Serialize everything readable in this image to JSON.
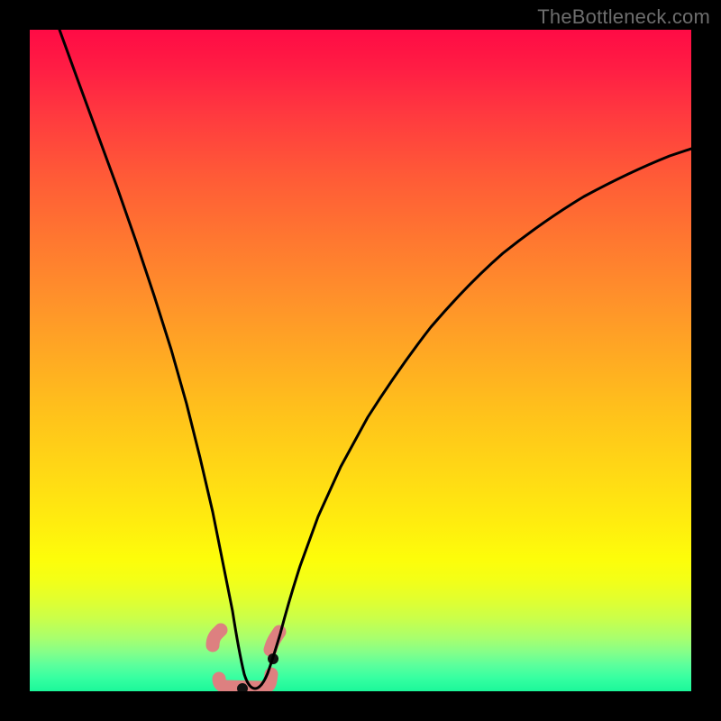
{
  "watermark": "TheBottleneck.com",
  "chart_data": {
    "type": "line",
    "title": "",
    "xlabel": "",
    "ylabel": "",
    "xlim": [
      0,
      100
    ],
    "ylim": [
      0,
      100
    ],
    "series": [
      {
        "name": "bottleneck-curve",
        "x": [
          0,
          2,
          4,
          6,
          8,
          10,
          12,
          14,
          16,
          18,
          20,
          22,
          24,
          26,
          27.5,
          29,
          30,
          31,
          32,
          33,
          34,
          35,
          36,
          37,
          38,
          40,
          43,
          46,
          50,
          55,
          60,
          65,
          70,
          75,
          80,
          85,
          90,
          95,
          100
        ],
        "values": [
          100,
          94,
          87,
          80,
          73,
          66,
          59,
          52,
          45,
          38,
          31,
          24,
          17,
          10,
          6,
          3,
          1.5,
          0.7,
          0.3,
          0.3,
          0.8,
          2,
          4,
          6.5,
          9,
          14,
          21,
          27,
          34,
          42,
          49,
          55,
          60,
          64.5,
          68.5,
          72,
          75,
          77.5,
          79.5
        ]
      },
      {
        "name": "marker-band",
        "x_range": [
          27,
          37
        ],
        "y_range": [
          0,
          7
        ]
      }
    ],
    "gradient_stops": [
      {
        "pos": 0,
        "color": "#ff0b45"
      },
      {
        "pos": 80,
        "color": "#fdfd0a"
      },
      {
        "pos": 100,
        "color": "#1cf79a"
      }
    ]
  }
}
